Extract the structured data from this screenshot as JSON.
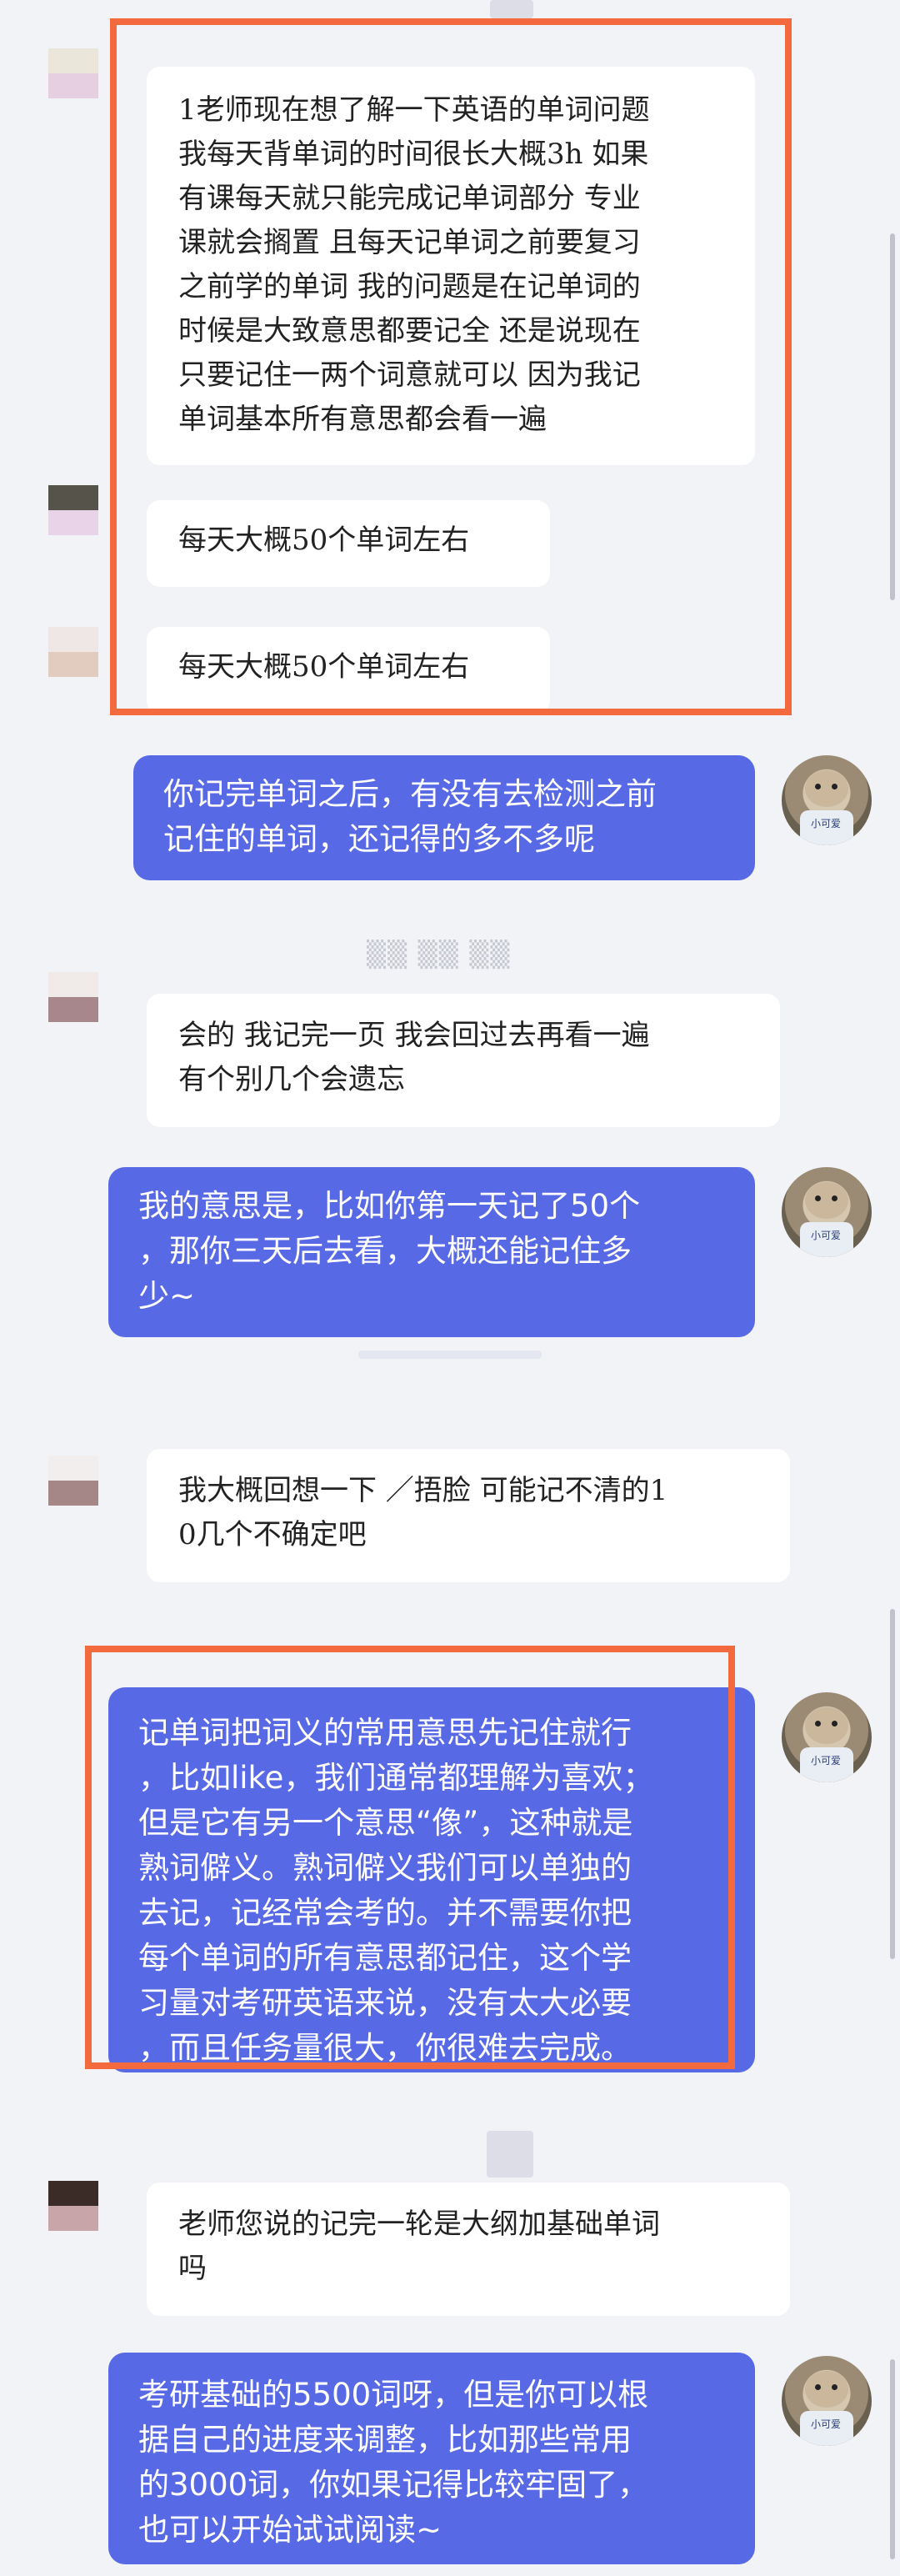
{
  "chat": {
    "incoming": [
      "1老师现在想了解一下英语的单词问题\n我每天背单词的时间很长大概3h 如果\n有课每天就只能完成记单词部分 专业\n课就会搁置 且每天记单词之前要复习\n之前学的单词 我的问题是在记单词的\n时候是大致意思都要记全 还是说现在\n只要记住一两个词意就可以 因为我记\n单词基本所有意思都会看一遍",
      "每天大概50个单词左右",
      "每天大概50个单词左右",
      "会的 我记完一页 我会回过去再看一遍\n 有个别几个会遗忘",
      "我大概回想一下 ／捂脸 可能记不清的1\n0几个不确定吧",
      "老师您说的记完一轮是大纲加基础单词\n吗"
    ],
    "outgoing": [
      "你记完单词之后，有没有去检测之前\n记住的单词，还记得的多不多呢",
      "我的意思是，比如你第一天记了50个\n，那你三天后去看，大概还能记住多\n少~",
      "记单词把词义的常用意思先记住就行\n，比如like，我们通常都理解为喜欢；\n但是它有另一个意思“像”，这种就是\n熟词僻义。熟词僻义我们可以单独的\n去记，记经常会考的。并不需要你把\n每个单词的所有意思都记住，这个学\n习量对考研英语来说，没有太大必要\n，而且任务量很大，你很难去完成。",
      "考研基础的5500词呀，但是你可以根\n据自己的进度来调整，比如那些常用\n的3000词，你如果记得比较牢固了，\n也可以开始试试阅读~"
    ],
    "teacher_avatar_tag": "小可爱"
  },
  "colors": {
    "background": "#f2f3f7",
    "incoming_bubble": "#ffffff",
    "outgoing_bubble": "#5869e6",
    "highlight_border": "#f26a3d"
  },
  "icons": {
    "student_avatar": "blurred-avatar-icon",
    "teacher_avatar": "cartoon-dog-avatar-icon"
  }
}
